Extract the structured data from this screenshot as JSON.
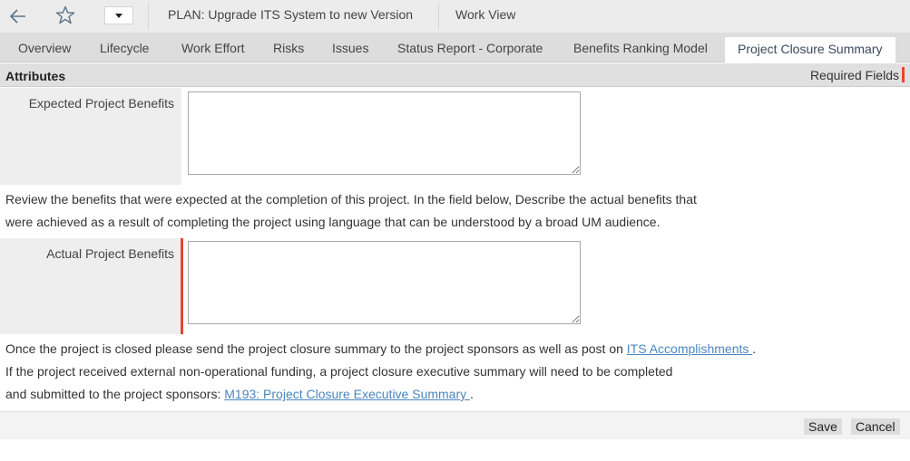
{
  "toolbar": {
    "back_icon": "arrow-left-icon",
    "favorite_icon": "star-outline-icon",
    "menu_icon": "caret-down-icon",
    "title": "PLAN:  Upgrade ITS System to new Version",
    "view_label": "Work View"
  },
  "tabs": [
    {
      "label": "Overview",
      "active": false
    },
    {
      "label": "Lifecycle",
      "active": false
    },
    {
      "label": "Work Effort",
      "active": false
    },
    {
      "label": "Risks",
      "active": false
    },
    {
      "label": "Issues",
      "active": false
    },
    {
      "label": "Status Report - Corporate",
      "active": false
    },
    {
      "label": "Benefits Ranking Model",
      "active": false
    },
    {
      "label": "Project Closure Summary",
      "active": true
    }
  ],
  "section": {
    "title": "Attributes",
    "required_label": "Required Fields",
    "required_color": "#e8462b"
  },
  "fields": {
    "expected": {
      "label": "Expected Project Benefits",
      "value": "",
      "required": false
    },
    "actual": {
      "label": "Actual Project Benefits",
      "value": "",
      "required": true
    }
  },
  "instructions": {
    "line1": "Review the benefits that were expected at the completion of this project. In the field below, Describe the actual benefits that",
    "line2": "were achieved as a result of completing the project using language that can be understood by a broad UM audience."
  },
  "closure_note": {
    "line1_prefix": "Once the project is closed please send the project closure summary to the project sponsors as well as post on ",
    "line1_link": "ITS Accomplishments ",
    "line1_suffix": ".",
    "line2": "If the project received external non-operational funding, a project closure executive summary will need to be completed",
    "line3_prefix": "and submitted to the project sponsors: ",
    "line3_link": "M193: Project Closure Executive Summary ",
    "line3_suffix": ".",
    "link_color": "#4a86c0"
  },
  "footer": {
    "save_label": "Save",
    "cancel_label": "Cancel"
  }
}
